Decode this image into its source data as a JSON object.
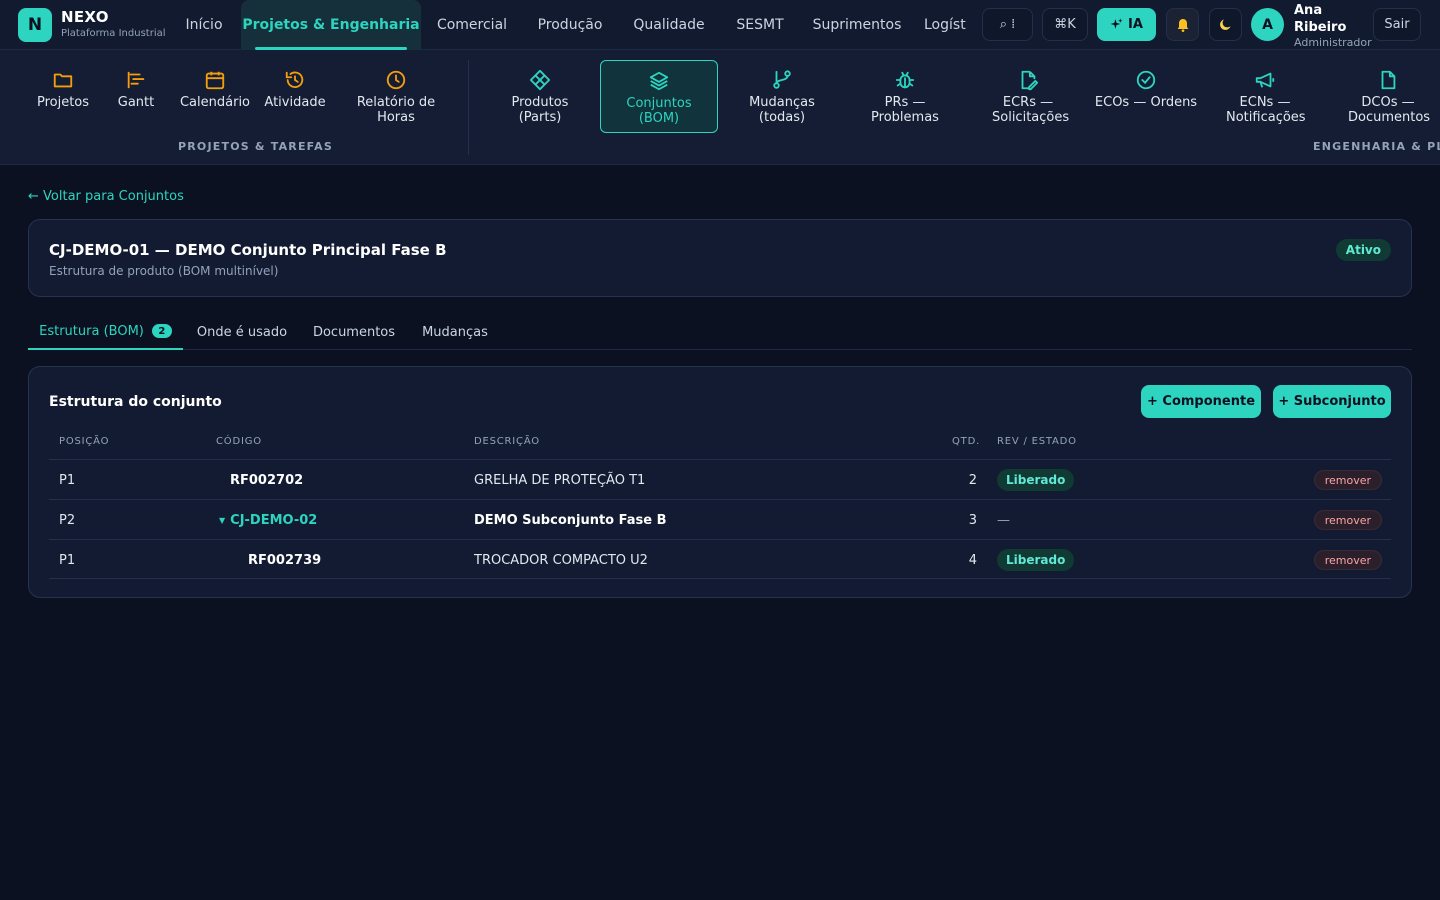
{
  "brand": {
    "logo_letter": "N",
    "name": "NEXO",
    "subtitle": "Plataforma Industrial"
  },
  "main_nav": [
    {
      "label": "Início",
      "active": false
    },
    {
      "label": "Projetos & Engenharia",
      "active": true
    },
    {
      "label": "Comercial",
      "active": false
    },
    {
      "label": "Produção",
      "active": false
    },
    {
      "label": "Qualidade",
      "active": false
    },
    {
      "label": "SESMT",
      "active": false
    },
    {
      "label": "Suprimentos",
      "active": false
    },
    {
      "label": "Logíst",
      "active": false
    }
  ],
  "toolbar": {
    "search_label": "⌕ ⁞",
    "shortcut_label": "⌘K",
    "ia_label": "IA",
    "theme_icon": "moon-icon",
    "bell_icon": "bell-icon",
    "logout_label": "Sair"
  },
  "user": {
    "initial": "A",
    "name": "Ana Ribeiro",
    "role": "Administrador"
  },
  "sub_nav": {
    "groups": [
      {
        "label": "PROJETOS & TAREFAS",
        "items": [
          {
            "label": "Projetos",
            "icon": "folder-icon"
          },
          {
            "label": "Gantt",
            "icon": "gantt-icon"
          },
          {
            "label": "Calendário",
            "icon": "calendar-icon"
          },
          {
            "label": "Atividade",
            "icon": "history-icon"
          },
          {
            "label": "Relatório de Horas",
            "icon": "clock-icon"
          }
        ]
      },
      {
        "label": "ENGENHARIA & PLM",
        "items": [
          {
            "label": "Produtos (Parts)",
            "icon": "parts-icon"
          },
          {
            "label": "Conjuntos (BOM)",
            "icon": "layers-icon",
            "active": true
          },
          {
            "label": "Mudanças (todas)",
            "icon": "branch-icon"
          },
          {
            "label": "PRs — Problemas",
            "icon": "bug-icon"
          },
          {
            "label": "ECRs — Solicitações",
            "icon": "file-edit-icon"
          },
          {
            "label": "ECOs — Ordens",
            "icon": "check-circle-icon"
          },
          {
            "label": "ECNs — Notificações",
            "icon": "megaphone-icon"
          },
          {
            "label": "DCOs — Documentos",
            "icon": "document-icon"
          }
        ]
      }
    ]
  },
  "back_link": "← Voltar para Conjuntos",
  "assembly": {
    "title": "CJ-DEMO-01 — DEMO Conjunto Principal Fase B",
    "subtitle": "Estrutura de produto (BOM multinível)",
    "status": "Ativo"
  },
  "tabs": [
    {
      "label": "Estrutura (BOM)",
      "count": "2",
      "active": true
    },
    {
      "label": "Onde é usado"
    },
    {
      "label": "Documentos"
    },
    {
      "label": "Mudanças"
    }
  ],
  "bom": {
    "title": "Estrutura do conjunto",
    "add_component_label": "+ Componente",
    "add_subassembly_label": "+ Subconjunto",
    "columns": [
      "POSIÇÃO",
      "CÓDIGO",
      "DESCRIÇÃO",
      "QTD.",
      "REV / ESTADO"
    ],
    "remove_label": "remover",
    "rows": [
      {
        "position": "P1",
        "code": "RF002702",
        "description": "GRELHA DE PROTEÇÃO T1",
        "qty": "2",
        "state": "Liberado",
        "level": 1,
        "is_assembly": false
      },
      {
        "position": "P2",
        "code": "CJ-DEMO-02",
        "description": "DEMO Subconjunto Fase B",
        "qty": "3",
        "state": "—",
        "level": 1,
        "is_assembly": true
      },
      {
        "position": "P1",
        "code": "RF002739",
        "description": "TROCADOR COMPACTO U2",
        "qty": "4",
        "state": "Liberado",
        "level": 2,
        "is_assembly": false
      }
    ]
  },
  "colors": {
    "accent": "#2dd4bf",
    "background": "#0b1120",
    "card": "#121b31",
    "danger_text": "#fca5a5"
  }
}
